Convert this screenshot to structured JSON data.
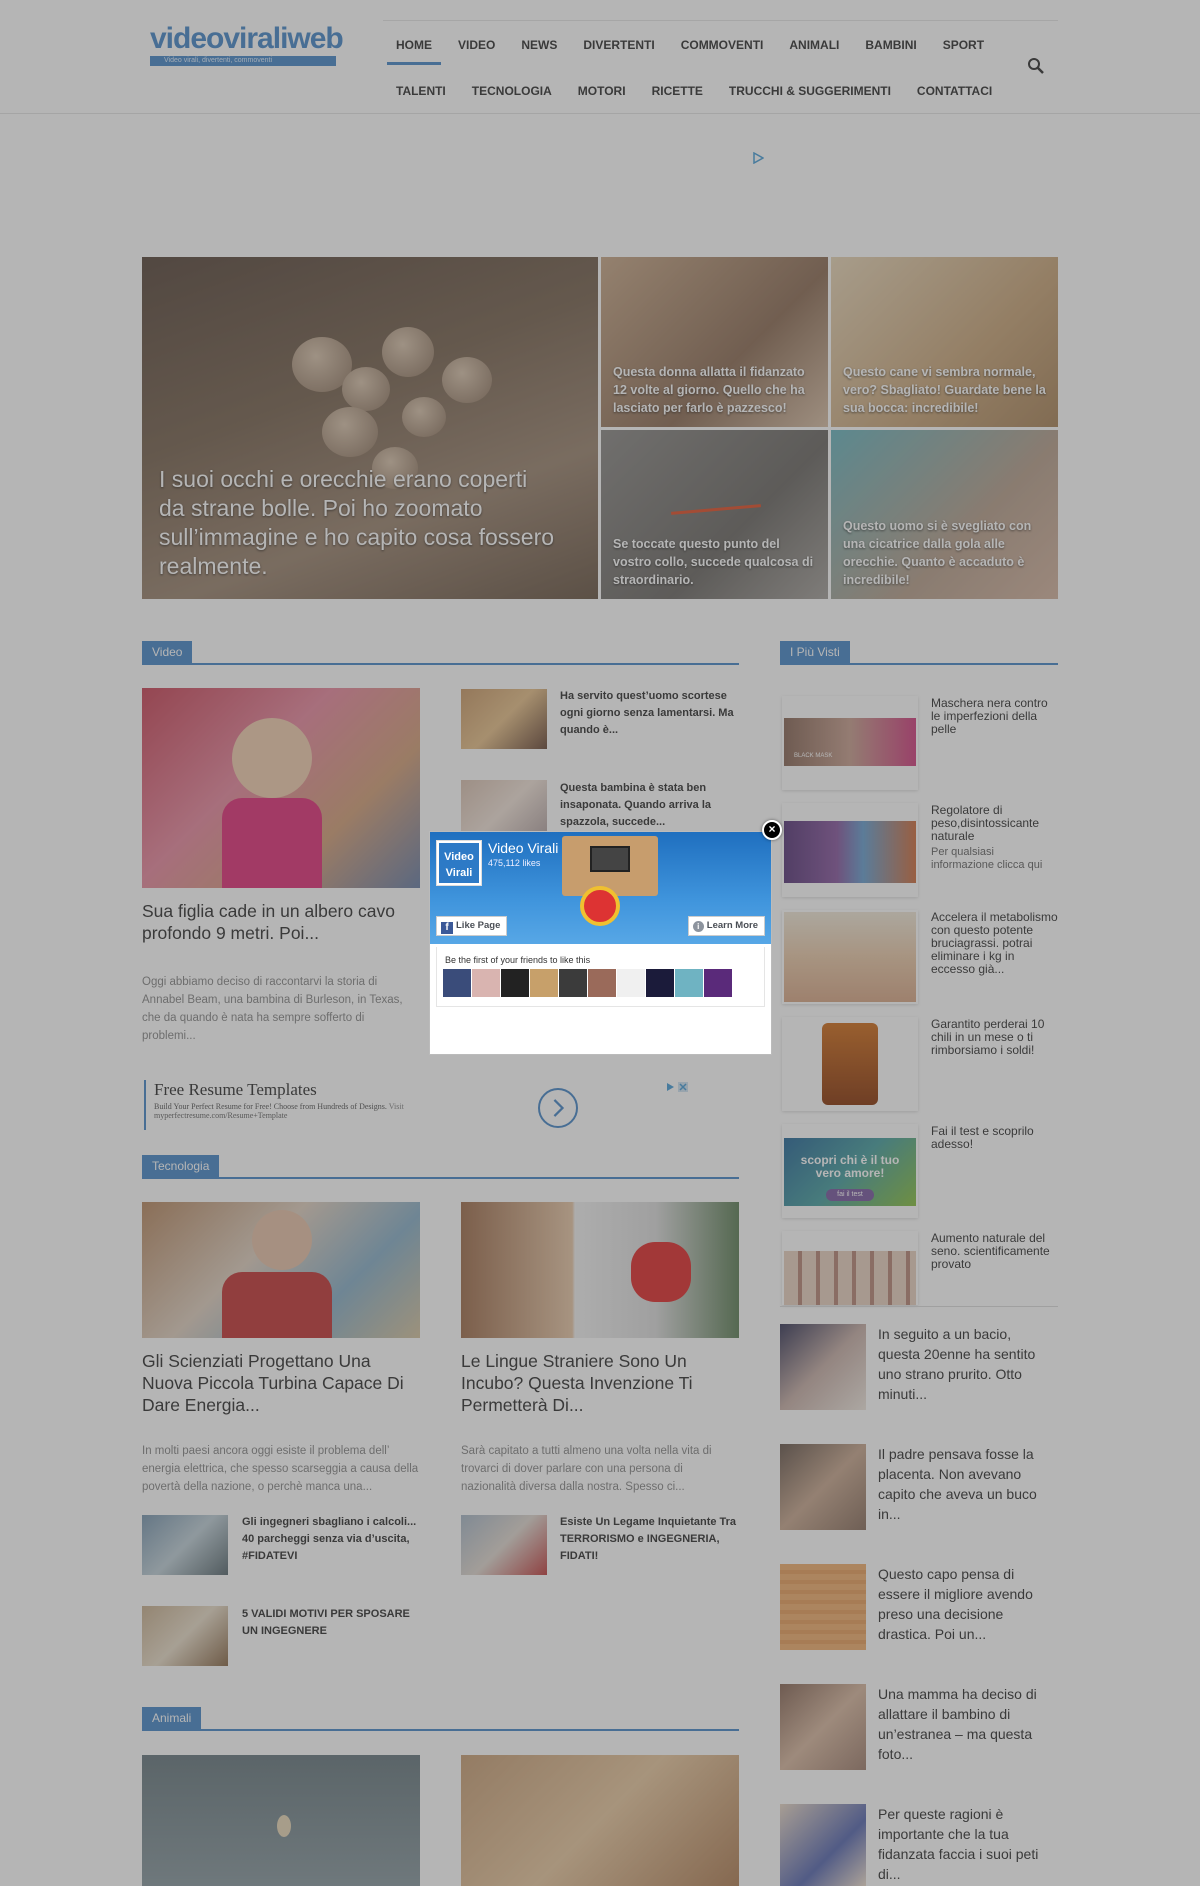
{
  "site": {
    "logo_text": "videoviraliweb",
    "logo_tagline": "Video virali, divertenti, commoventi"
  },
  "nav": {
    "row1": [
      "HOME",
      "VIDEO",
      "NEWS",
      "DIVERTENTI",
      "COMMOVENTI",
      "ANIMALI",
      "BAMBINI",
      "SPORT"
    ],
    "row2": [
      "TALENTI",
      "TECNOLOGIA",
      "MOTORI",
      "RICETTE",
      "TRUCCHI & SUGGERIMENTI",
      "CONTATTACI"
    ],
    "active": "HOME"
  },
  "hero": {
    "big_title": "I suoi occhi e orecchie erano coperti da strane bolle. Poi ho zoomato sull’immagine e ho capito cosa fossero realmente.",
    "tiles": [
      "Questa donna allatta il fidanzato 12 volte al giorno. Quello che ha lasciato per farlo è pazzesco!",
      "Questo cane vi sembra normale, vero? Sbagliato! Guardate bene la sua bocca: incredibile!",
      "Se toccate questo punto del vostro collo, succede qualcosa di straordinario.",
      "Questo uomo si è svegliato con una cicatrice dalla gola alle orecchie. Quanto è accaduto è incredibile!"
    ]
  },
  "video_section": {
    "label": "Video",
    "main_title": "Sua figlia cade in un albero cavo profondo 9 metri. Poi...",
    "main_excerpt": "Oggi abbiamo deciso di raccontarvi la storia di Annabel Beam, una bambina di Burleson, in Texas, che da quando è nata ha sempre sofferto di problemi...",
    "side_items": [
      "Ha servito quest’uomo scortese ogni giorno senza lamentarsi. Ma quando è...",
      "Questa bambina è stata ben insaponata. Quando arriva la spazzola, succede..."
    ]
  },
  "resume_ad": {
    "title": "Free Resume Templates",
    "subtitle": "Build Your Perfect Resume for Free! Choose from Hundreds of Designs.",
    "visit": "Visit",
    "url": "myperfectresume.com/Resume+Template"
  },
  "tech_section": {
    "label": "Tecnologia",
    "cards": [
      {
        "title": "Gli Scienziati Progettano Una Nuova Piccola Turbina Capace Di Dare Energia...",
        "excerpt": "In molti paesi ancora oggi esiste il problema dell’ energia elettrica, che spesso scarseggia a causa della povertà della nazione, o perchè manca una..."
      },
      {
        "title": "Le Lingue Straniere Sono Un Incubo? Questa Invenzione Ti Permetterà Di...",
        "excerpt": "Sarà capitato a tutti almeno una volta nella vita di trovarci di dover parlare con una persona di nazionalità diversa dalla nostra. Spesso ci..."
      }
    ],
    "small_items": [
      "Gli ingegneri sbagliano i calcoli... 40 parcheggi senza via d’uscita, #FIDATEVI",
      "Esiste Un Legame Inquietante Tra TERRORISMO e INGEGNERIA, FIDATI!",
      "5 VALIDI MOTIVI PER SPOSARE UN INGEGNERE"
    ]
  },
  "animali_section": {
    "label": "Animali"
  },
  "right_column": {
    "label": "I Più Visti",
    "ads": [
      {
        "title": "Maschera nera contro le imperfezioni della pelle",
        "sub": "",
        "badge": "BLACK MASK"
      },
      {
        "title": "Regolatore di peso,disintossicante naturale",
        "sub": "Per qualsiasi informazione clicca qui",
        "badge": ""
      },
      {
        "title": "Accelera il metabolismo con questo potente bruciagrassi. potrai eliminare i kg in eccesso già...",
        "sub": "",
        "badge": ""
      },
      {
        "title": "Garantito perderai 10 chili in un mese o ti rimborsiamo i soldi!",
        "sub": "",
        "badge": ""
      },
      {
        "title": "Fai il test e scoprilo adesso!",
        "sub": "",
        "badge": "scopri chi è il tuo vero amore!",
        "button": "fai il test"
      },
      {
        "title": "Aumento naturale del seno. scientificamente provato",
        "sub": "",
        "badge": ""
      }
    ],
    "list": [
      "In seguito a un bacio, questa 20enne ha sentito uno strano prurito. Otto minuti...",
      "Il padre pensava fosse la placenta. Non avevano capito che aveva un buco in...",
      "Questo capo pensa di essere il migliore avendo preso una decisione drastica. Poi un...",
      "Una mamma ha deciso di allattare il bambino di un’estranea – ma questa foto...",
      "Per queste ragioni è importante che la tua fidanzata faccia i suoi peti di..."
    ]
  },
  "fb_popup": {
    "page_name": "Video Virali",
    "likes": "475,112 likes",
    "logo_line1": "Video",
    "logo_line2": "Virali",
    "like_button": "Like Page",
    "learn_more": "Learn More",
    "friends_text": "Be the first of your friends to like this",
    "close": "×",
    "face_colors": [
      "#3a4c7a",
      "#d9b4b0",
      "#222222",
      "#c7a06a",
      "#3b3b3b",
      "#9a6a5a",
      "#f0f0f0",
      "#1b1b3a",
      "#6fb3c2",
      "#5a2a7a"
    ]
  },
  "colors": {
    "accent": "#4a89c8",
    "overlay": "rgba(70,70,70,0.4)"
  }
}
